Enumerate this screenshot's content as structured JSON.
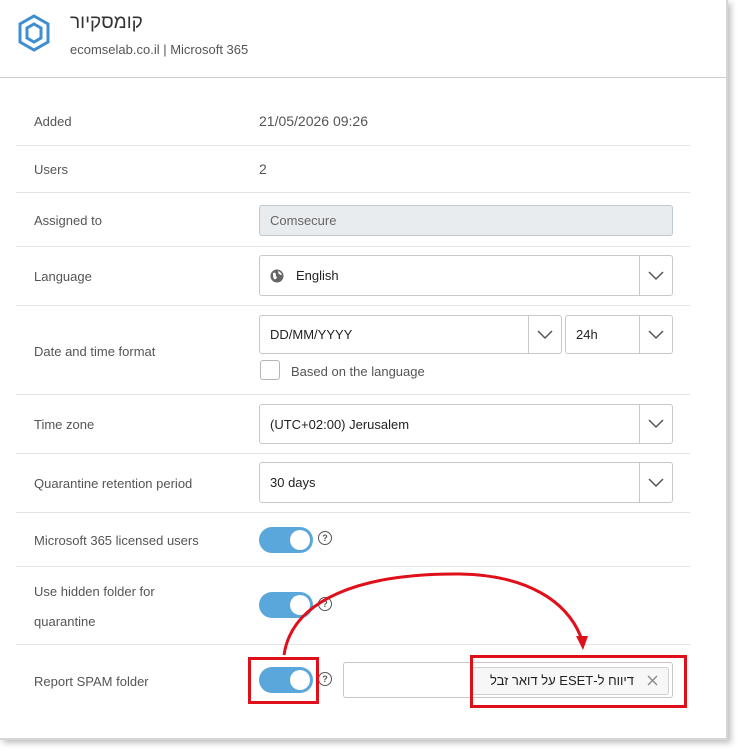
{
  "header": {
    "title": "קומסקיור",
    "subtitle": "ecomselab.co.il | Microsoft 365",
    "logo_icon": "hexagon-logo-icon"
  },
  "rows": {
    "added": {
      "label": "Added",
      "value": "21/05/2026 09:26"
    },
    "users": {
      "label": "Users",
      "value": "2"
    },
    "assigned": {
      "label": "Assigned to",
      "value": "Comsecure"
    },
    "language": {
      "label": "Language",
      "value": "English"
    },
    "datetime": {
      "label": "Date and time format",
      "date_value": "DD/MM/YYYY",
      "time_value": "24h",
      "checkbox_label": "Based on the language"
    },
    "timezone": {
      "label": "Time zone",
      "value": "(UTC+02:00) Jerusalem"
    },
    "quarantine": {
      "label": "Quarantine retention period",
      "value": "30 days"
    },
    "licensed": {
      "label": "Microsoft 365 licensed users",
      "toggle_on": true
    },
    "hidden_folder": {
      "label_line1": "Use hidden folder for",
      "label_line2": "quarantine",
      "toggle_on": true
    },
    "report_spam": {
      "label": "Report SPAM folder",
      "toggle_on": true,
      "folder_tag": "דיווח ל-ESET על דואר זבל"
    }
  },
  "colors": {
    "toggle": "#5aa7dc",
    "annotation": "#e0101a",
    "logo": "#3d8fd1"
  }
}
